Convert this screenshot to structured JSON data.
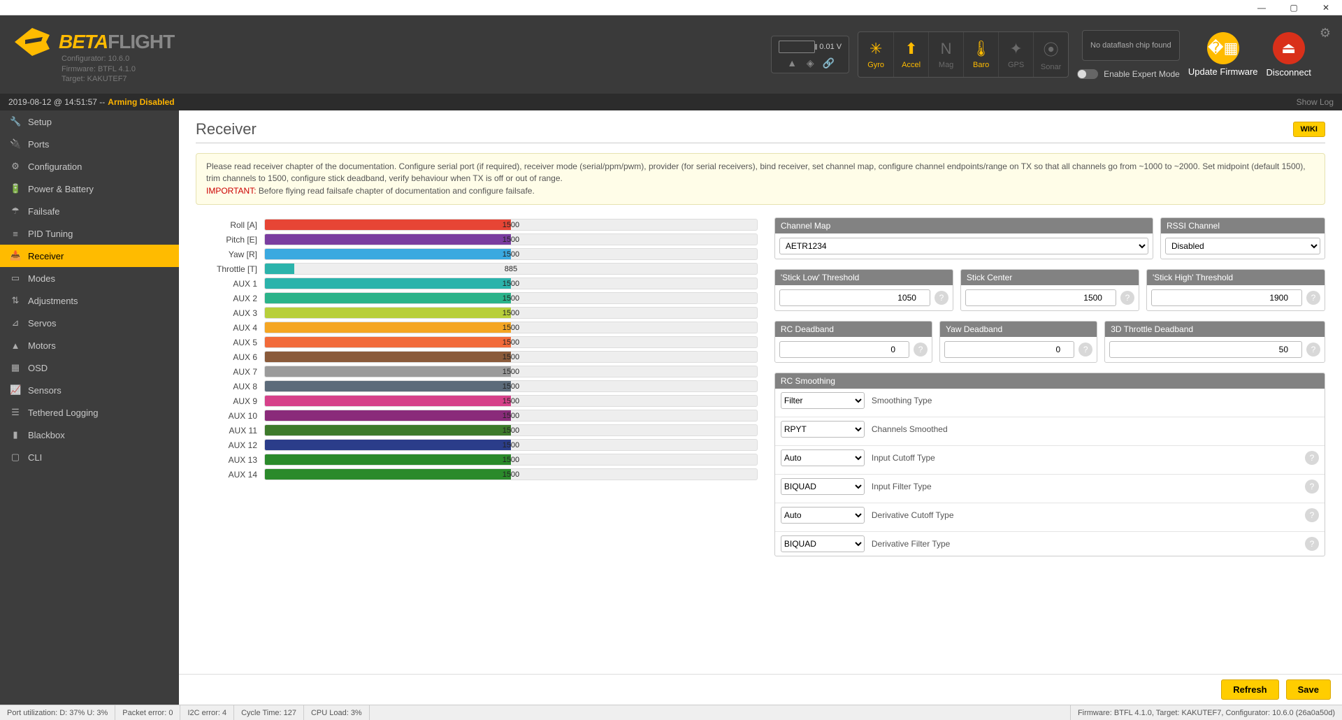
{
  "window": {
    "min": "—",
    "max": "▢",
    "close": "✕"
  },
  "header": {
    "brand_beta": "BETA",
    "brand_flight": "FLIGHT",
    "meta1": "Configurator: 10.6.0",
    "meta2": "Firmware: BTFL 4.1.0",
    "meta3": "Target: KAKUTEF7",
    "battery_v": "0.01 V",
    "sensors": [
      {
        "label": "Gyro",
        "on": true,
        "glyph": "✳"
      },
      {
        "label": "Accel",
        "on": true,
        "glyph": "⬆"
      },
      {
        "label": "Mag",
        "on": false,
        "glyph": "N"
      },
      {
        "label": "Baro",
        "on": true,
        "glyph": "🌡"
      },
      {
        "label": "GPS",
        "on": false,
        "glyph": "✦"
      },
      {
        "label": "Sonar",
        "on": false,
        "glyph": "⦿"
      }
    ],
    "dataflash": "No dataflash chip found",
    "expert": "Enable Expert Mode",
    "update_fw": "Update Firmware",
    "disconnect": "Disconnect"
  },
  "armbar": {
    "ts": "2019-08-12 @ 14:51:57 -- ",
    "status": "Arming Disabled",
    "showlog": "Show Log"
  },
  "sidebar": [
    {
      "icon": "🔧",
      "label": "Setup"
    },
    {
      "icon": "🔌",
      "label": "Ports"
    },
    {
      "icon": "⚙",
      "label": "Configuration"
    },
    {
      "icon": "🔋",
      "label": "Power & Battery"
    },
    {
      "icon": "☂",
      "label": "Failsafe"
    },
    {
      "icon": "≡",
      "label": "PID Tuning"
    },
    {
      "icon": "📥",
      "label": "Receiver"
    },
    {
      "icon": "▭",
      "label": "Modes"
    },
    {
      "icon": "⇅",
      "label": "Adjustments"
    },
    {
      "icon": "⊿",
      "label": "Servos"
    },
    {
      "icon": "▲",
      "label": "Motors"
    },
    {
      "icon": "▦",
      "label": "OSD"
    },
    {
      "icon": "📈",
      "label": "Sensors"
    },
    {
      "icon": "☰",
      "label": "Tethered Logging"
    },
    {
      "icon": "▮",
      "label": "Blackbox"
    },
    {
      "icon": "▢",
      "label": "CLI"
    }
  ],
  "page": {
    "title": "Receiver",
    "wiki": "WIKI",
    "notice_main": "Please read receiver chapter of the documentation. Configure serial port (if required), receiver mode (serial/ppm/pwm), provider (for serial receivers), bind receiver, set channel map, configure channel endpoints/range on TX so that all channels go from ~1000 to ~2000. Set midpoint (default 1500), trim channels to 1500, configure stick deadband, verify behaviour when TX is off or out of range.",
    "notice_imp_label": "IMPORTANT:",
    "notice_imp_text": " Before flying read failsafe chapter of documentation and configure failsafe."
  },
  "channels": [
    {
      "label": "Roll [A]",
      "value": 1500,
      "fill": 50,
      "color": "#e74535"
    },
    {
      "label": "Pitch [E]",
      "value": 1500,
      "fill": 50,
      "color": "#7a3da0"
    },
    {
      "label": "Yaw [R]",
      "value": 1500,
      "fill": 50,
      "color": "#3aa9e0"
    },
    {
      "label": "Throttle [T]",
      "value": 885,
      "fill": 6,
      "color": "#2bb3ab"
    },
    {
      "label": "AUX 1",
      "value": 1500,
      "fill": 50,
      "color": "#2bb3ab"
    },
    {
      "label": "AUX 2",
      "value": 1500,
      "fill": 50,
      "color": "#2bb38a"
    },
    {
      "label": "AUX 3",
      "value": 1500,
      "fill": 50,
      "color": "#b8cf3a"
    },
    {
      "label": "AUX 4",
      "value": 1500,
      "fill": 50,
      "color": "#f5a623"
    },
    {
      "label": "AUX 5",
      "value": 1500,
      "fill": 50,
      "color": "#f26b3a"
    },
    {
      "label": "AUX 6",
      "value": 1500,
      "fill": 50,
      "color": "#8a5a3a"
    },
    {
      "label": "AUX 7",
      "value": 1500,
      "fill": 50,
      "color": "#9b9b9b"
    },
    {
      "label": "AUX 8",
      "value": 1500,
      "fill": 50,
      "color": "#5c6b7a"
    },
    {
      "label": "AUX 9",
      "value": 1500,
      "fill": 50,
      "color": "#d6418a"
    },
    {
      "label": "AUX 10",
      "value": 1500,
      "fill": 50,
      "color": "#8a2b7a"
    },
    {
      "label": "AUX 11",
      "value": 1500,
      "fill": 50,
      "color": "#3d7a2b"
    },
    {
      "label": "AUX 12",
      "value": 1500,
      "fill": 50,
      "color": "#2b3d8a"
    },
    {
      "label": "AUX 13",
      "value": 1500,
      "fill": 50,
      "color": "#2b8a2b"
    },
    {
      "label": "AUX 14",
      "value": 1500,
      "fill": 50,
      "color": "#2b8a2b"
    }
  ],
  "right": {
    "channel_map_h": "Channel Map",
    "channel_map_v": "AETR1234",
    "rssi_h": "RSSI Channel",
    "rssi_v": "Disabled",
    "stick_low_h": "'Stick Low' Threshold",
    "stick_low_v": "1050",
    "stick_center_h": "Stick Center",
    "stick_center_v": "1500",
    "stick_high_h": "'Stick High' Threshold",
    "stick_high_v": "1900",
    "rc_deadband_h": "RC Deadband",
    "rc_deadband_v": "0",
    "yaw_deadband_h": "Yaw Deadband",
    "yaw_deadband_v": "0",
    "td_deadband_h": "3D Throttle Deadband",
    "td_deadband_v": "50",
    "smoothing_h": "RC Smoothing",
    "smoothing": [
      {
        "value": "Filter",
        "label": "Smoothing Type",
        "help": false
      },
      {
        "value": "RPYT",
        "label": "Channels Smoothed",
        "help": false
      },
      {
        "value": "Auto",
        "label": "Input Cutoff Type",
        "help": true
      },
      {
        "value": "BIQUAD",
        "label": "Input Filter Type",
        "help": true
      },
      {
        "value": "Auto",
        "label": "Derivative Cutoff Type",
        "help": true
      },
      {
        "value": "BIQUAD",
        "label": "Derivative Filter Type",
        "help": true
      }
    ]
  },
  "footer_btns": {
    "refresh": "Refresh",
    "save": "Save"
  },
  "status": {
    "port": "Port utilization: D: 37% U: 3%",
    "packet": "Packet error: 0",
    "i2c": "I2C error: 4",
    "cycle": "Cycle Time: 127",
    "cpu": "CPU Load: 3%",
    "right": "Firmware: BTFL 4.1.0, Target: KAKUTEF7, Configurator: 10.6.0 (26a0a50d)"
  }
}
